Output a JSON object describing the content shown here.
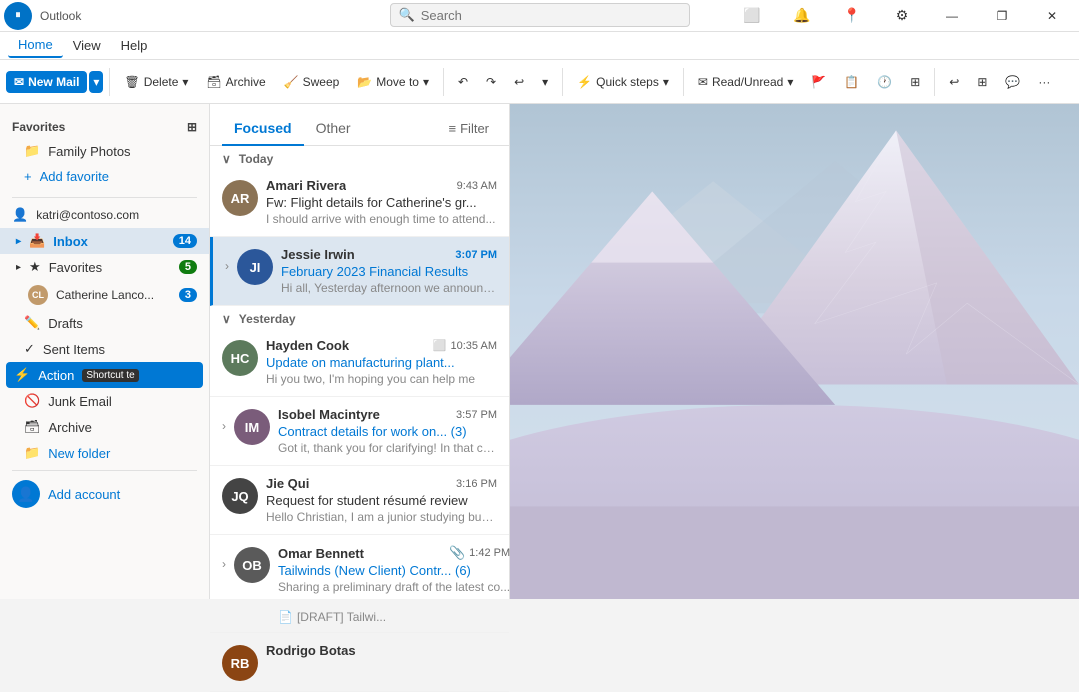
{
  "titleBar": {
    "appName": "Outlook",
    "windowControls": [
      "—",
      "❐",
      "✕"
    ]
  },
  "searchBar": {
    "placeholder": "Search"
  },
  "menuBar": {
    "items": [
      "Home",
      "View",
      "Help"
    ],
    "activeItem": "Home"
  },
  "toolbar": {
    "newMail": "New Mail",
    "delete": "Delete",
    "archive": "Archive",
    "sweep": "Sweep",
    "moveTo": "Move to",
    "undo": "↶",
    "redo": "↷",
    "quickSteps": "Quick steps",
    "readUnread": "Read/Unread",
    "more": "···"
  },
  "sidebar": {
    "favoritesLabel": "Favorites",
    "favoriteItems": [
      {
        "label": "Family Photos",
        "icon": "📁",
        "badge": null
      },
      {
        "label": "Add favorite",
        "icon": "+",
        "badge": null
      }
    ],
    "account": "katri@contoso.com",
    "folders": [
      {
        "label": "Inbox",
        "icon": "📥",
        "badge": "14",
        "active": true
      },
      {
        "label": "Favorites",
        "icon": "★",
        "badge": "5"
      },
      {
        "label": "Catherine Lanco...",
        "icon": "👤",
        "badge": "3"
      },
      {
        "label": "Drafts",
        "icon": "✏️",
        "badge": null
      },
      {
        "label": "Sent Items",
        "icon": "✓",
        "badge": null
      },
      {
        "label": "Action",
        "shortcut": "Shortcut te",
        "icon": "⚡",
        "badge": null,
        "dark": true
      },
      {
        "label": "Junk Email",
        "icon": "🚫",
        "badge": null
      },
      {
        "label": "Archive",
        "icon": "🗃",
        "badge": null
      }
    ],
    "newFolder": "New folder",
    "addAccount": "Add account"
  },
  "emailList": {
    "tabs": [
      {
        "label": "Focused",
        "active": true
      },
      {
        "label": "Other",
        "active": false
      }
    ],
    "filterLabel": "Filter",
    "sections": [
      {
        "dateLabel": "Today",
        "emails": [
          {
            "sender": "Amari Rivera",
            "subject": "Fw: Flight details for Catherine's gr...",
            "preview": "I should arrive with enough time to attend...",
            "time": "9:43 AM",
            "timeUnread": false,
            "avatarColor": "#8b7355",
            "avatarInitial": "AR",
            "unread": false,
            "selected": false,
            "hasAttachment": false,
            "expanded": false
          },
          {
            "sender": "Jessie Irwin",
            "subject": "February 2023 Financial Results",
            "preview": "Hi all, Yesterday afternoon we announced...",
            "time": "3:07 PM",
            "timeUnread": true,
            "avatarColor": "#2b579a",
            "avatarInitial": "JI",
            "unread": true,
            "selected": true,
            "hasAttachment": false,
            "expanded": false
          }
        ]
      },
      {
        "dateLabel": "Yesterday",
        "emails": [
          {
            "sender": "Hayden Cook",
            "subject": "Update on manufacturing plant...",
            "preview": "Hi you two, I'm hoping you can help me",
            "time": "10:35 AM",
            "timeUnread": false,
            "avatarColor": "#5c7a5c",
            "avatarInitial": "HC",
            "unread": false,
            "selected": false,
            "hasAttachment": false,
            "expanded": false,
            "hasFlag": true
          },
          {
            "sender": "Isobel Macintyre",
            "subject": "Contract details for work on... (3)",
            "preview": "Got it, thank you for clarifying! In that case...",
            "time": "3:57 PM",
            "timeUnread": false,
            "avatarColor": "#7a5c7a",
            "avatarInitial": "IM",
            "unread": false,
            "selected": false,
            "hasAttachment": false,
            "expanded": false
          },
          {
            "sender": "Jie Qui",
            "subject": "Request for student résumé review",
            "preview": "Hello Christian, I am a junior studying busi...",
            "time": "3:16 PM",
            "timeUnread": false,
            "avatarColor": "#444",
            "avatarInitial": "JQ",
            "unread": false,
            "selected": false,
            "hasAttachment": false,
            "expanded": false
          },
          {
            "sender": "Omar Bennett",
            "subject": "Tailwinds (New Client) Contr... (6)",
            "preview": "Sharing a preliminary draft of the latest co...",
            "time": "1:42 PM",
            "timeUnread": false,
            "avatarColor": "#5a5a5a",
            "avatarInitial": "OB",
            "unread": false,
            "selected": false,
            "hasAttachment": true,
            "expanded": true,
            "draftLabel": "[DRAFT] Tailwi..."
          },
          {
            "sender": "Rodrigo Botas",
            "subject": "",
            "preview": "",
            "time": "",
            "timeUnread": false,
            "avatarColor": "#8b4513",
            "avatarInitial": "RB",
            "unread": false,
            "selected": false,
            "hasAttachment": false,
            "expanded": false
          }
        ]
      }
    ]
  }
}
